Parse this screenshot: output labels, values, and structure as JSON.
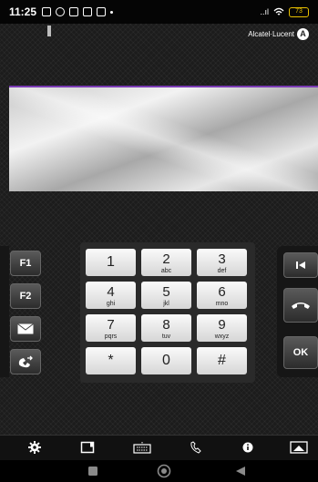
{
  "status_bar": {
    "time": "11:25",
    "signal_text": "..ıl",
    "battery": "73"
  },
  "brand": {
    "name": "Alcatel·Lucent"
  },
  "left_buttons": [
    "F1",
    "F2"
  ],
  "right_buttons": {
    "ok_label": "OK"
  },
  "keypad": {
    "keys": [
      {
        "digit": "1",
        "letters": ""
      },
      {
        "digit": "2",
        "letters": "abc"
      },
      {
        "digit": "3",
        "letters": "def"
      },
      {
        "digit": "4",
        "letters": "ghi"
      },
      {
        "digit": "5",
        "letters": "jkl"
      },
      {
        "digit": "6",
        "letters": "mno"
      },
      {
        "digit": "7",
        "letters": "pqrs"
      },
      {
        "digit": "8",
        "letters": "tuv"
      },
      {
        "digit": "9",
        "letters": "wxyz"
      },
      {
        "digit": "*",
        "letters": ""
      },
      {
        "digit": "0",
        "letters": ""
      },
      {
        "digit": "#",
        "letters": ""
      }
    ]
  },
  "colors": {
    "accent_purple": "#7a3bb4",
    "battery_yellow": "#e8c000"
  },
  "icons": {
    "toolbar": [
      "gear-icon",
      "notebook-icon",
      "keyboard-icon",
      "handset-icon",
      "info-icon",
      "screen-icon"
    ],
    "nav": [
      "square-icon",
      "circle-icon",
      "back-triangle-icon"
    ]
  }
}
